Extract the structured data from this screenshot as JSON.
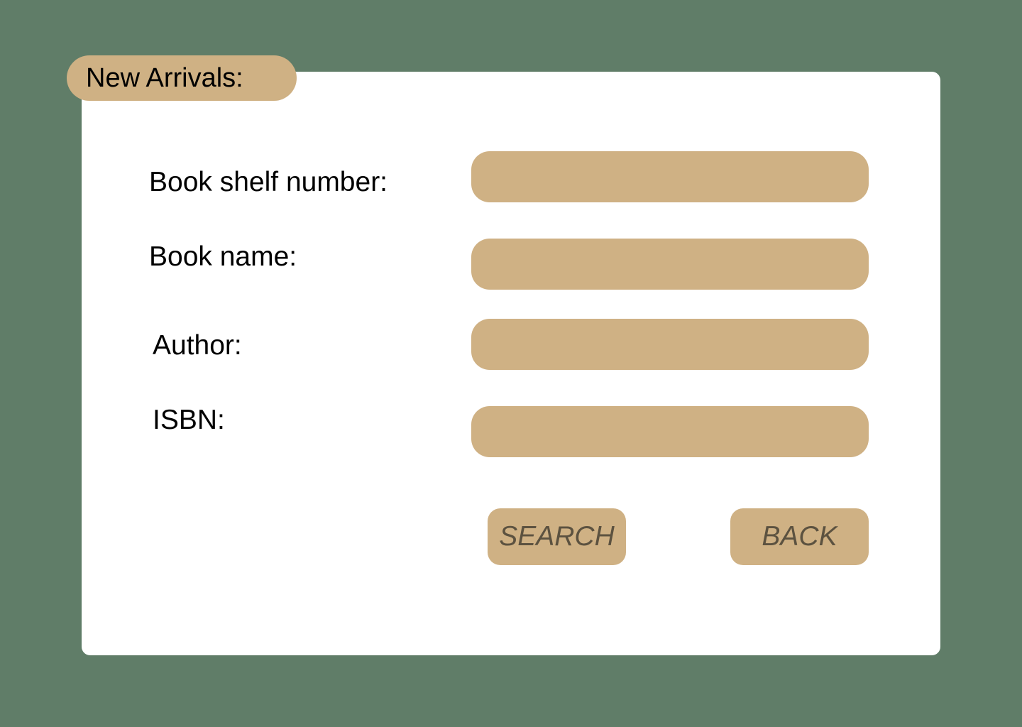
{
  "header": {
    "title": "New Arrivals:"
  },
  "form": {
    "fields": [
      {
        "label": "Book shelf number:",
        "value": "",
        "placeholder": ""
      },
      {
        "label": "Book name:",
        "value": "",
        "placeholder": ""
      },
      {
        "label": "Author:",
        "value": "",
        "placeholder": ""
      },
      {
        "label": "ISBN:",
        "value": "",
        "placeholder": ""
      }
    ]
  },
  "actions": {
    "search_label": "SEARCH",
    "back_label": "BACK"
  },
  "colors": {
    "background": "#607d68",
    "panel": "#ffffff",
    "accent": "#cfb184",
    "button_text": "#5c5240"
  }
}
